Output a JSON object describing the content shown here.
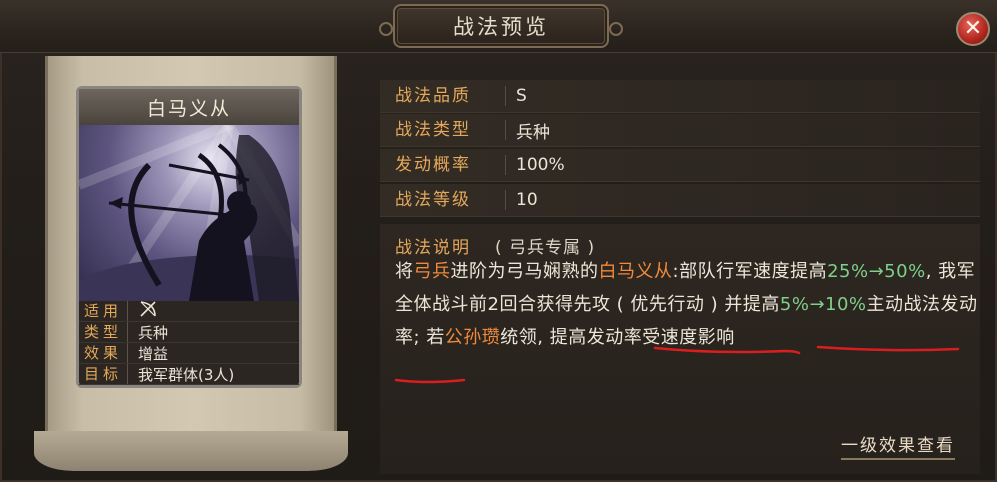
{
  "window": {
    "title": "战法预览",
    "close_icon": "close-icon"
  },
  "card": {
    "name": "白马义从",
    "stats": [
      {
        "label": "适用",
        "value": "",
        "icon": "bow-crossed-icon"
      },
      {
        "label": "类型",
        "value": "兵种"
      },
      {
        "label": "效果",
        "value": "增益"
      },
      {
        "label": "目标",
        "value": "我军群体(3人)"
      }
    ]
  },
  "info": {
    "rows": [
      {
        "label": "战法品质",
        "value": "S"
      },
      {
        "label": "战法类型",
        "value": "兵种"
      },
      {
        "label": "发动概率",
        "value": "100%"
      },
      {
        "label": "战法等级",
        "value": "10"
      }
    ]
  },
  "description": {
    "label": "战法说明",
    "subtitle": "( 弓兵专属 )",
    "segments": [
      {
        "t": "将",
        "c": ""
      },
      {
        "t": "弓兵",
        "c": "orange"
      },
      {
        "t": "进阶为弓马娴熟的",
        "c": ""
      },
      {
        "t": "白马义从",
        "c": "orange"
      },
      {
        "t": ":部队行军速度提高",
        "c": ""
      },
      {
        "t": "25%→50%",
        "c": "green"
      },
      {
        "t": ", 我军全体战斗前2回合获得先攻 ( 优先行动 ) 并提高",
        "c": ""
      },
      {
        "t": "5%→10%",
        "c": "green"
      },
      {
        "t": "主动战法发动率; 若",
        "c": ""
      },
      {
        "t": "公孙瓒",
        "c": "orange"
      },
      {
        "t": "统领, 提高发动率受速度影响",
        "c": ""
      }
    ]
  },
  "link": {
    "label": "一级效果查看"
  },
  "colors": {
    "accent": "#e4a85a",
    "highlight": "#f08a3c",
    "upgrade": "#7fd08a",
    "underline": "#d81e1e"
  }
}
